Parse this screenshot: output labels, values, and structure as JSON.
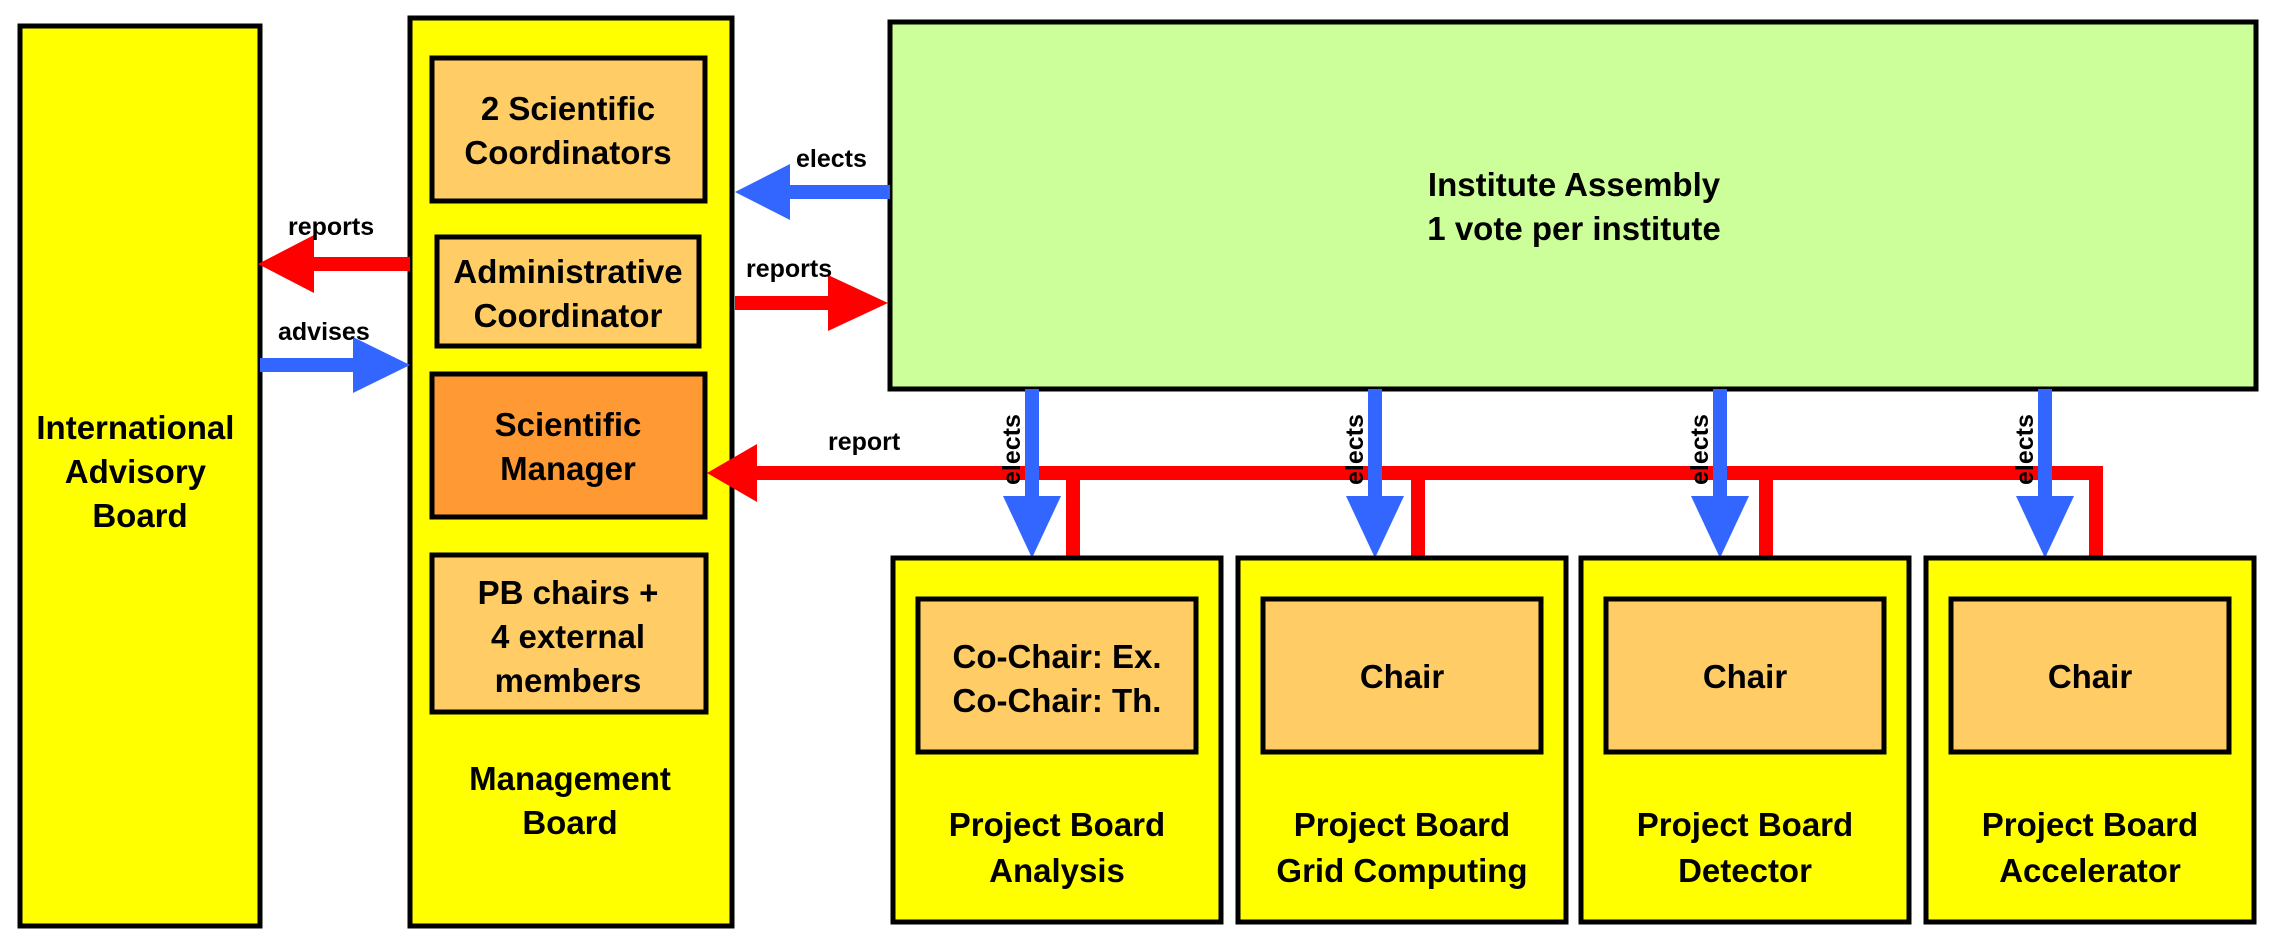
{
  "colors": {
    "board": "#ffff00",
    "sub_box": "#ffcc66",
    "manager_box": "#ff9933",
    "assembly": "#ccff99",
    "elects_arrow": "#3366ff",
    "reports_arrow": "#ff0000"
  },
  "iab": {
    "lines": [
      "International",
      "Advisory",
      "Board"
    ]
  },
  "management_board": {
    "label": [
      "Management",
      "Board"
    ],
    "coordinators": [
      "2 Scientific",
      "Coordinators"
    ],
    "admin": [
      "Administrative",
      "Coordinator"
    ],
    "manager": [
      "Scientific",
      "Manager"
    ],
    "pb_chairs": [
      "PB chairs +",
      "4 external",
      "members"
    ]
  },
  "assembly": {
    "lines": [
      "Institute Assembly",
      "1 vote per institute"
    ]
  },
  "edges": {
    "reports_left": "reports",
    "advises": "advises",
    "elects": "elects",
    "reports_right": "reports",
    "report": "report"
  },
  "project_boards": [
    {
      "chair": [
        "Co-Chair: Ex.",
        "Co-Chair: Th."
      ],
      "label": [
        "Project Board",
        "Analysis"
      ]
    },
    {
      "chair": [
        "Chair"
      ],
      "label": [
        "Project Board",
        "Grid Computing"
      ]
    },
    {
      "chair": [
        "Chair"
      ],
      "label": [
        "Project Board",
        "Detector"
      ]
    },
    {
      "chair": [
        "Chair"
      ],
      "label": [
        "Project Board",
        "Accelerator"
      ]
    }
  ]
}
